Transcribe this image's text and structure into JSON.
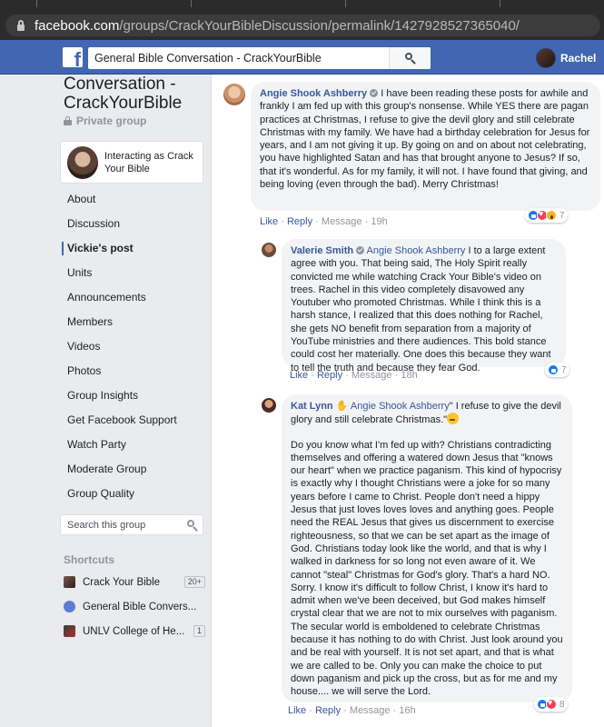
{
  "browser": {
    "url_host": "facebook.com",
    "url_path": "/groups/CrackYourBibleDiscussion/permalink/1427928527365040/"
  },
  "topbar": {
    "search_value": "General Bible Conversation - CrackYourBible",
    "user_name": "Rachel",
    "logo_letter": "f"
  },
  "sidebar": {
    "group_title": "Conversation - CrackYourBible",
    "privacy": "Private group",
    "acting_as": "Interacting as Crack Your Bible",
    "nav": [
      "About",
      "Discussion",
      "Vickie's post",
      "Units",
      "Announcements",
      "Members",
      "Videos",
      "Photos",
      "Group Insights",
      "Get Facebook Support",
      "Watch Party",
      "Moderate Group",
      "Group Quality"
    ],
    "active_nav": "Vickie's post",
    "search_placeholder": "Search this group",
    "shortcuts_header": "Shortcuts",
    "shortcuts": [
      {
        "label": "Crack Your Bible",
        "count": "20+"
      },
      {
        "label": "General Bible Convers...",
        "count": ""
      },
      {
        "label": "UNLV College of He...",
        "count": "1"
      }
    ]
  },
  "comments": [
    {
      "author": "Angie Shook Ashberry",
      "text": "I have been reading these posts for awhile and frankly I am fed up with this group's nonsense. While YES there are pagan practices at Christmas, I refuse to give the devil glory and still celebrate Christmas with my family. We have had a birthday celebration for Jesus for years, and I am not giving it up. By going on and on about not celebrating, you have highlighted Satan and has that brought anyone to Jesus? If so, that it's wonderful. As for my family, it will not. I have found that giving, and being loving (even through the bad). Merry Christmas!",
      "like": "Like",
      "reply": "Reply",
      "meta": "Message",
      "time": "19h",
      "reactions": "7"
    },
    {
      "author": "Valerie Smith",
      "mention": "Angie Shook Ashberry",
      "text": "I to a large extent agree with you. That being said, The Holy Spirit really convicted me while watching Crack Your Bible's video on trees. Rachel in this video completely disavowed any Youtuber who promoted Christmas. While I think this is a harsh stance, I realized that this does nothing for Rachel, she gets NO benefit from separation from a majority of YouTube ministries and there audiences. This bold stance could cost her materially. One does this because they want to tell the truth and because they fear God.",
      "like": "Like",
      "reply": "Reply",
      "meta": "Message",
      "time": "18h",
      "reactions": "7"
    },
    {
      "author": "Kat Lynn",
      "mention": "Angie Shook Ashberry",
      "quote": "\" I refuse to give the devil glory and still celebrate Christmas.\"",
      "text": "Do you know what I'm fed up with? Christians contradicting themselves and offering a watered down Jesus that \"knows our heart\" when we practice paganism. This kind of hypocrisy is exactly why I thought Christians were a joke for so many years before I came to Christ. People don't need a hippy Jesus that just loves loves loves and anything goes. People need the REAL Jesus that gives us discernment to exercise righteousness, so that we can be set apart as the image of God. Christians today look like the world, and that is why I walked in darkness for so long not even aware of it. We cannot \"steal\" Christmas for God's glory. That's a hard NO. Sorry. I know it's difficult to follow Christ, I know it's hard to admit when we've been deceived, but God makes himself crystal clear that we are not to mix ourselves with paganism. The secular world is emboldened to celebrate Christmas because it has nothing to do with Christ. Just look around you and be real with yourself. It is not set apart, and that is what we are called to be. Only you can make the choice to put down paganism and pick up the cross, but as for me and my house.... we will serve the Lord.",
      "like": "Like",
      "reply": "Reply",
      "meta": "Message",
      "time": "16h",
      "reactions": "8"
    }
  ],
  "separators": {
    "dot": "·"
  },
  "colors": {
    "fb_blue": "#4267b2",
    "link": "#385898",
    "bubble": "#f2f3f5"
  }
}
